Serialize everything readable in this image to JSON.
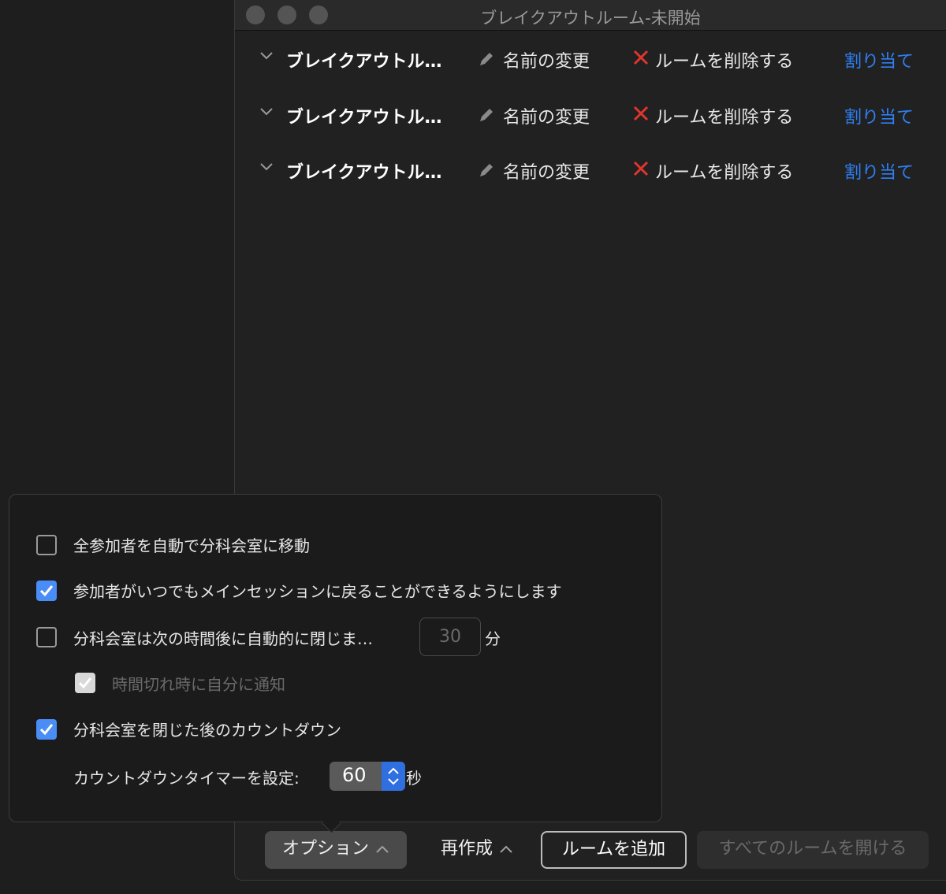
{
  "window": {
    "title": "ブレイクアウトルーム-未開始"
  },
  "rooms": [
    {
      "name": "ブレイクアウトル…",
      "rename_label": "名前の変更",
      "delete_label": "ルームを削除する",
      "assign_label": "割り当て"
    },
    {
      "name": "ブレイクアウトル…",
      "rename_label": "名前の変更",
      "delete_label": "ルームを削除する",
      "assign_label": "割り当て"
    },
    {
      "name": "ブレイクアウトル…",
      "rename_label": "名前の変更",
      "delete_label": "ルームを削除する",
      "assign_label": "割り当て"
    }
  ],
  "options": {
    "auto_move": {
      "label": "全参加者を自動で分科会室に移動",
      "checked": false
    },
    "return_anytime": {
      "label": "参加者がいつでもメインセッションに戻ることができるようにします",
      "checked": true
    },
    "auto_close": {
      "label": "分科会室は次の時間後に自動的に閉じま…",
      "checked": false,
      "minutes": "30",
      "unit": "分"
    },
    "notify_timeout": {
      "label": "時間切れ時に自分に通知",
      "checked": true,
      "disabled": true
    },
    "countdown": {
      "label": "分科会室を閉じた後のカウントダウン",
      "checked": true
    },
    "countdown_timer": {
      "label": "カウントダウンタイマーを設定:",
      "value": "60",
      "unit": "秒"
    }
  },
  "footer": {
    "options_label": "オプション",
    "recreate_label": "再作成",
    "add_room_label": "ルームを追加",
    "open_all_label": "すべてのルームを開ける"
  },
  "colors": {
    "accent": "#2f7ff2",
    "checkbox_on": "#4a8df6",
    "delete_x": "#e0352f"
  }
}
